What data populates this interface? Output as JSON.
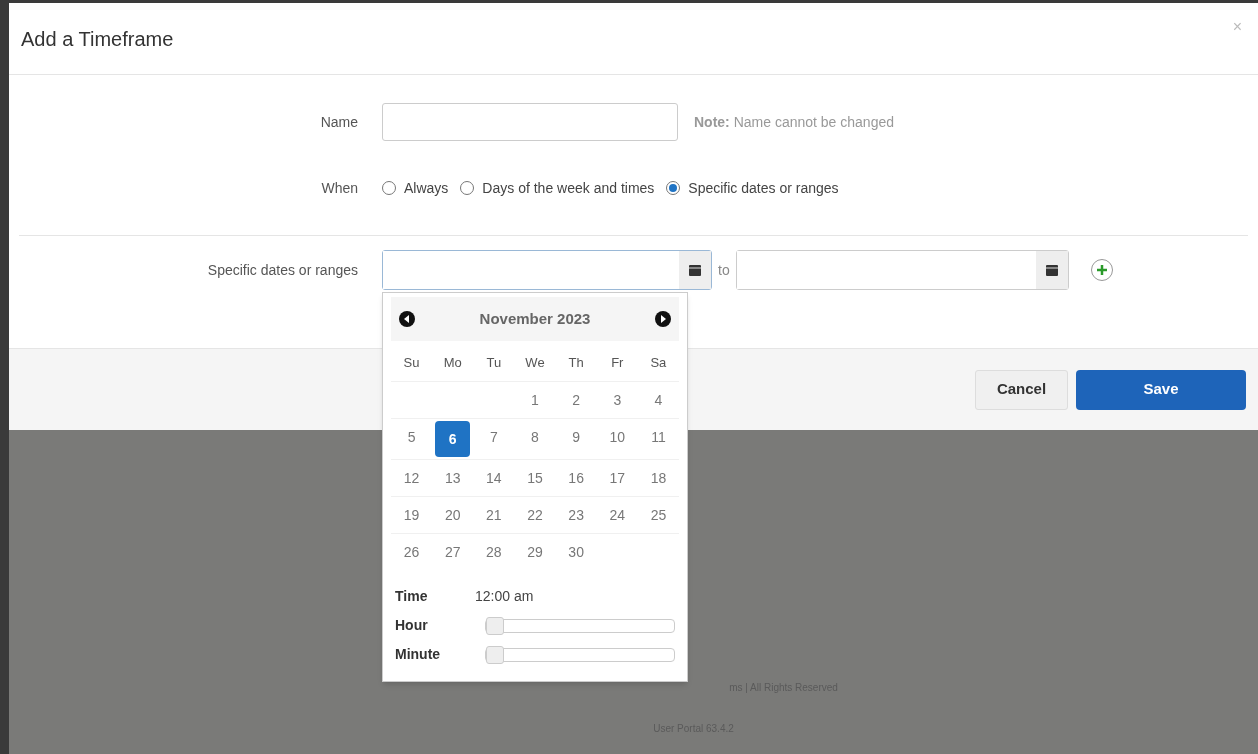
{
  "dialog": {
    "title": "Add a Timeframe",
    "close": "×"
  },
  "name_field": {
    "label": "Name",
    "note": "**Note:** Name cannot be changed"
  },
  "when": {
    "label": "When",
    "options": [
      {
        "label": "Always",
        "selected": false
      },
      {
        "label": "Days of the week and times",
        "selected": false
      },
      {
        "label": "Specific dates or ranges",
        "selected": true
      }
    ]
  },
  "dates": {
    "label": "Specific dates or ranges",
    "separator": "to"
  },
  "calendar": {
    "month": "November 2023",
    "weekdays": [
      "Su",
      "Mo",
      "Tu",
      "We",
      "Th",
      "Fr",
      "Sa"
    ],
    "weeks": [
      {
        "days": [
          {
            "day": "1",
            "selected": false
          },
          {
            "day": "2",
            "selected": false
          },
          {
            "day": "3",
            "selected": false
          },
          {
            "day": "4",
            "selected": false
          }
        ]
      },
      {
        "days": [
          {
            "day": "5",
            "selected": false
          },
          {
            "day": "6",
            "selected": true
          },
          {
            "day": "7",
            "selected": false
          },
          {
            "day": "8",
            "selected": false
          },
          {
            "day": "9",
            "selected": false
          },
          {
            "day": "10",
            "selected": false
          },
          {
            "day": "11",
            "selected": false
          }
        ]
      },
      {
        "days": [
          {
            "day": "12",
            "selected": false
          },
          {
            "day": "13",
            "selected": false
          },
          {
            "day": "14",
            "selected": false
          },
          {
            "day": "15",
            "selected": false
          },
          {
            "day": "16",
            "selected": false
          },
          {
            "day": "17",
            "selected": false
          },
          {
            "day": "18",
            "selected": false
          }
        ]
      },
      {
        "days": [
          {
            "day": "19",
            "selected": false
          },
          {
            "day": "20",
            "selected": false
          },
          {
            "day": "21",
            "selected": false
          },
          {
            "day": "22",
            "selected": false
          },
          {
            "day": "23",
            "selected": false
          },
          {
            "day": "24",
            "selected": false
          },
          {
            "day": "25",
            "selected": false
          }
        ]
      },
      {
        "days": [
          {
            "day": "26",
            "selected": false
          },
          {
            "day": "27",
            "selected": false
          },
          {
            "day": "28",
            "selected": false
          },
          {
            "day": "29",
            "selected": false
          },
          {
            "day": "30",
            "selected": false
          }
        ]
      }
    ],
    "time_label": "Time",
    "time_value": "12:00 am",
    "sliders": [
      {
        "label": "Hour",
        "level": 0
      },
      {
        "label": "Minute",
        "level": 0
      }
    ]
  },
  "buttons": [
    {
      "label": "Cancel",
      "kind": "secondary"
    },
    {
      "label": "Save",
      "kind": "primary"
    }
  ],
  "page_footer": {
    "copyright": "ms | All Rights Reserved",
    "version": "User Portal 63.4.2"
  }
}
